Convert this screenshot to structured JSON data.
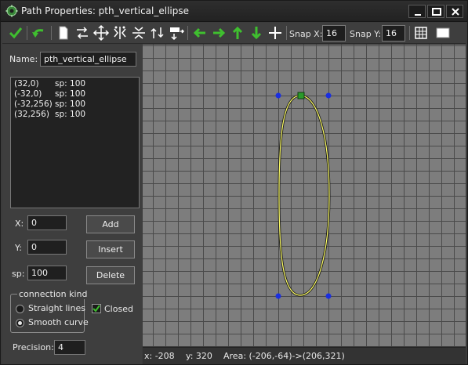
{
  "window": {
    "title": "Path Properties: pth_vertical_ellipse",
    "icon": "gear-icon",
    "controls": [
      "minimize-icon",
      "maximize-icon",
      "close-icon"
    ]
  },
  "toolbar": {
    "buttons": [
      "ok-check-icon",
      "undo-icon",
      "clear-page-icon",
      "reverse-icon",
      "shift-icon",
      "mirror-horizontal-icon",
      "flip-vertical-icon",
      "rotate-icon",
      "scale-icon",
      "shift-left-icon",
      "shift-right-icon",
      "shift-up-icon",
      "shift-down-icon",
      "center-icon",
      "grid-icon",
      "room-icon"
    ],
    "snap_x_label": "Snap X:",
    "snap_x_value": "16",
    "snap_y_label": "Snap Y:",
    "snap_y_value": "16",
    "accent_green": "#3fbf2f"
  },
  "left": {
    "name_label": "Name:",
    "name_value": "pth_vertical_ellipse",
    "points": [
      {
        "coord": "(32,0)",
        "speed": "sp: 100"
      },
      {
        "coord": "(-32,0)",
        "speed": "sp: 100"
      },
      {
        "coord": "(-32,256)",
        "speed": "sp: 100"
      },
      {
        "coord": "(32,256)",
        "speed": "sp: 100"
      }
    ],
    "x_label": "X:",
    "x_value": "0",
    "y_label": "Y:",
    "y_value": "0",
    "sp_label": "sp:",
    "sp_value": "100",
    "add_label": "Add",
    "insert_label": "Insert",
    "delete_label": "Delete",
    "connection_label": "connection kind",
    "straight_label": "Straight lines",
    "smooth_label": "Smooth curve",
    "connection_selected": "smooth",
    "closed_label": "Closed",
    "closed_checked": true,
    "precision_label": "Precision:",
    "precision_value": "4"
  },
  "canvas": {
    "grid_color": "#4a4a4a",
    "background_color": "#7d7d7d",
    "path_color": "#ffff66",
    "point_color": "#1a2fe0",
    "start_point_color": "#2a9a2a"
  },
  "status": {
    "x": "x: -208",
    "y": "y: 320",
    "area": "Area: (-206,-64)->(206,321)"
  }
}
